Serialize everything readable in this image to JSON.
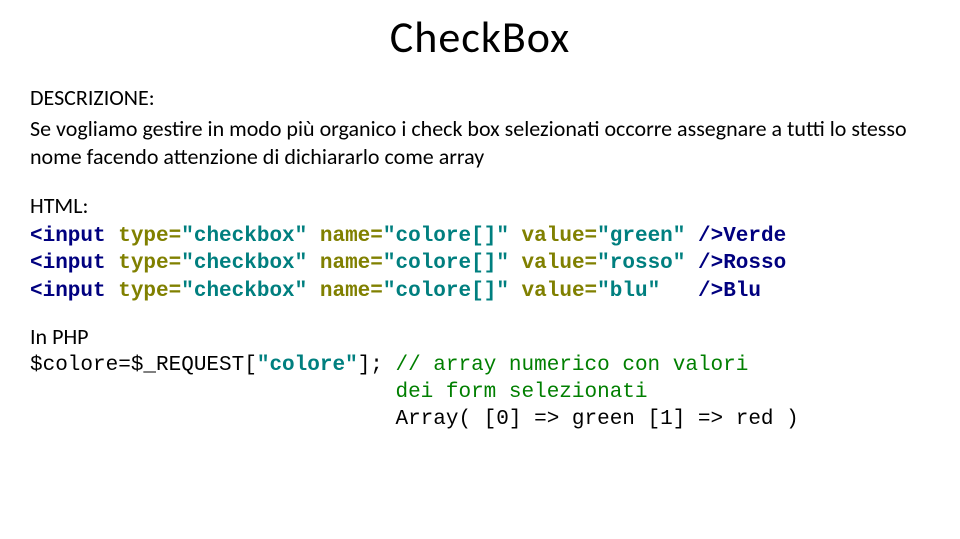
{
  "title": "CheckBox",
  "sectionDesc": "DESCRIZIONE:",
  "descText": "Se vogliamo gestire in modo più organico i check box selezionati occorre assegnare a tutti lo stesso nome facendo attenzione di dichiararlo come array",
  "htmlLabel": "HTML:",
  "code": {
    "l1_open": "<input ",
    "l1_typeAttr": "type=",
    "l1_typeVal": "\"checkbox\"",
    "l1_nameAttr": " name=",
    "l1_nameVal": "\"",
    "l1_nameBold": "colore[]",
    "l1_nameClose": "\"",
    "l1_valueAttr": " value=",
    "l1_valueVal": "\"",
    "l1_valueBold": "green",
    "l1_valueClose": "\"",
    "l1_close": " />Verde",
    "l2_open": "<input ",
    "l2_typeAttr": "type=",
    "l2_typeVal": "\"checkbox\"",
    "l2_nameAttr": " name=",
    "l2_nameVal": "\"",
    "l2_nameBold": "colore[]",
    "l2_nameClose": "\"",
    "l2_valueAttr": " value=",
    "l2_valueVal": "\"",
    "l2_valueBold": "rosso",
    "l2_valueClose": "\"",
    "l2_close": " />Rosso",
    "l3_open": "<input ",
    "l3_typeAttr": "type=",
    "l3_typeVal": "\"checkbox\"",
    "l3_nameAttr": " name=",
    "l3_nameVal": "\"",
    "l3_nameBold": "colore[]",
    "l3_nameClose": "\"",
    "l3_valueAttr": " value=",
    "l3_valueVal": "\"",
    "l3_valueBold": "blu",
    "l3_valueClose": "\"",
    "l3_close": "   />Blu"
  },
  "phpLabel": "In PHP",
  "php": {
    "line1_a": "$colore=$_REQUEST[",
    "line1_b": "\"",
    "line1_c": "colore",
    "line1_d": "\"",
    "line1_e": "]; ",
    "line1_cm": "// array numerico con valori",
    "line2_pad": "                             ",
    "line2_cm": "dei form selezionati",
    "line3_pad": "                             ",
    "line3": "Array( [0] => green [1] => red )"
  }
}
